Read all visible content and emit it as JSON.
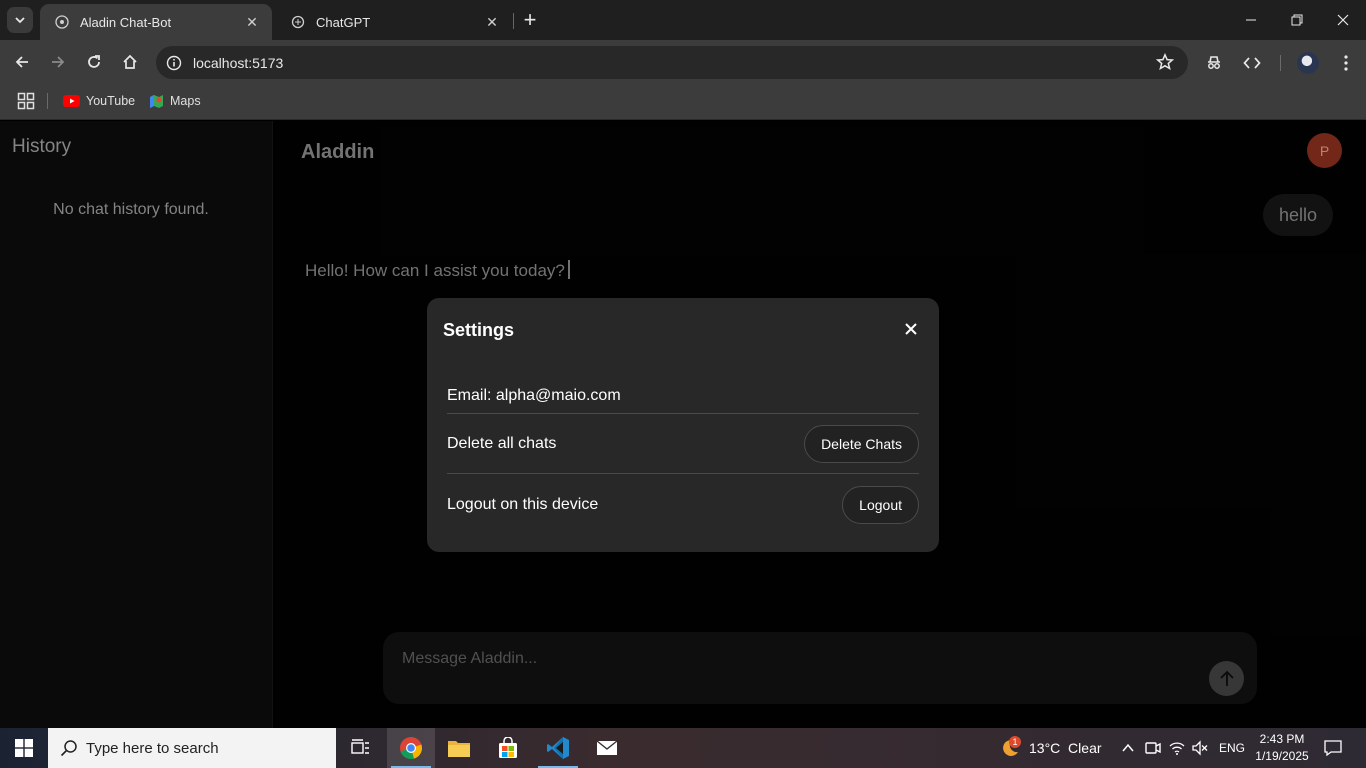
{
  "browser": {
    "tabs": [
      {
        "title": "Aladin Chat-Bot",
        "active": true
      },
      {
        "title": "ChatGPT",
        "active": false
      }
    ],
    "url": "localhost:5173",
    "bookmarks": [
      {
        "label": "YouTube",
        "icon": "youtube-icon"
      },
      {
        "label": "Maps",
        "icon": "maps-icon"
      }
    ]
  },
  "sidebar": {
    "title": "History",
    "empty_text": "No chat history found."
  },
  "chat": {
    "app_title": "Aladdin",
    "avatar_initial": "P",
    "user_message": "hello",
    "bot_message": "Hello! How can I assist you today?",
    "input_placeholder": "Message Aladdin..."
  },
  "settings_modal": {
    "title": "Settings",
    "email_line": "Email: alpha@maio.com",
    "delete_label": "Delete all chats",
    "delete_button": "Delete Chats",
    "logout_label": "Logout on this device",
    "logout_button": "Logout"
  },
  "taskbar": {
    "search_placeholder": "Type here to search",
    "weather": "13°C  Clear",
    "weather_badge": "1",
    "language": "ENG",
    "time": "2:43 PM",
    "date": "1/19/2025"
  },
  "colors": {
    "modal_bg": "#282828",
    "page_bg": "#000000",
    "avatar_bg": "#7a2a1a"
  }
}
